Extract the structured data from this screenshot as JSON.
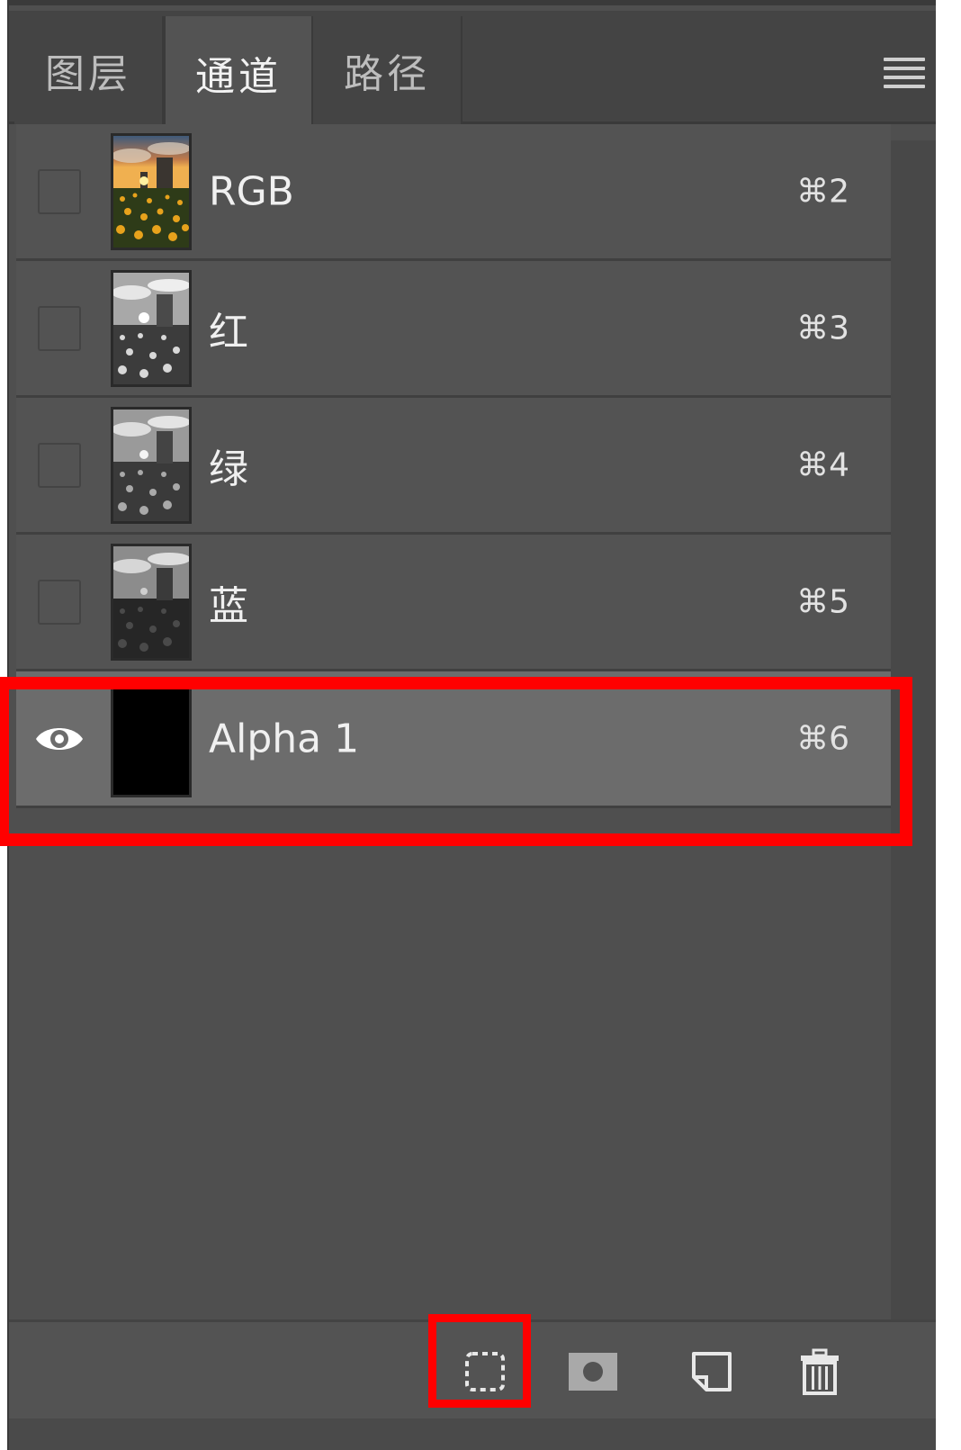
{
  "tabs": [
    {
      "label": "图层",
      "active": false
    },
    {
      "label": "通道",
      "active": true
    },
    {
      "label": "路径",
      "active": false
    }
  ],
  "channels": [
    {
      "name": "RGB",
      "shortcut": "⌘2",
      "visible": false,
      "thumb": "color"
    },
    {
      "name": "红",
      "shortcut": "⌘3",
      "visible": false,
      "thumb": "gray-light"
    },
    {
      "name": "绿",
      "shortcut": "⌘4",
      "visible": false,
      "thumb": "gray-mid"
    },
    {
      "name": "蓝",
      "shortcut": "⌘5",
      "visible": false,
      "thumb": "gray-dark"
    },
    {
      "name": "Alpha 1",
      "shortcut": "⌘6",
      "visible": true,
      "selected": true,
      "thumb": "black"
    }
  ],
  "toolbar": {
    "icons": [
      "load-selection-icon",
      "save-selection-icon",
      "new-channel-icon",
      "trash-icon"
    ]
  },
  "highlight_color": "#ff0000"
}
